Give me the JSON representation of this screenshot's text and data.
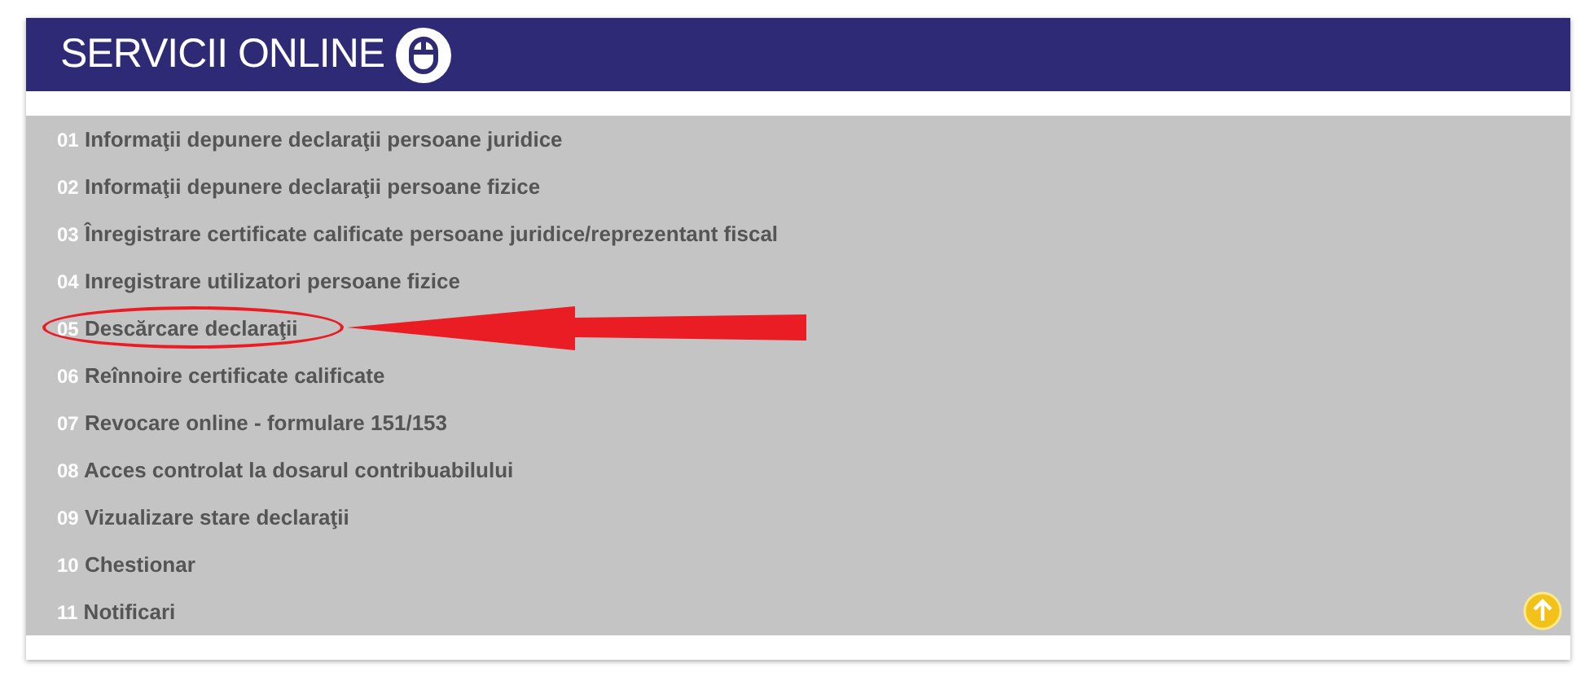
{
  "header": {
    "title": "SERVICII ONLINE"
  },
  "items": [
    {
      "number": "01",
      "label": "Informaţii depunere declaraţii persoane juridice",
      "highlighted": false
    },
    {
      "number": "02",
      "label": "Informaţii depunere declaraţii persoane fizice",
      "highlighted": false
    },
    {
      "number": "03",
      "label": "Înregistrare certificate calificate persoane juridice/reprezentant fiscal",
      "highlighted": false
    },
    {
      "number": "04",
      "label": "Inregistrare utilizatori persoane fizice",
      "highlighted": false
    },
    {
      "number": "05",
      "label": "Descărcare declaraţii",
      "highlighted": true
    },
    {
      "number": "06",
      "label": "Reînnoire certificate calificate",
      "highlighted": false
    },
    {
      "number": "07",
      "label": "Revocare online - formulare 151/153",
      "highlighted": false
    },
    {
      "number": "08",
      "label": "Acces controlat la dosarul contribuabilului",
      "highlighted": false
    },
    {
      "number": "09",
      "label": "Vizualizare stare declaraţii",
      "highlighted": false
    },
    {
      "number": "10",
      "label": "Chestionar",
      "highlighted": false
    },
    {
      "number": "11",
      "label": "Notificari",
      "highlighted": false
    }
  ]
}
